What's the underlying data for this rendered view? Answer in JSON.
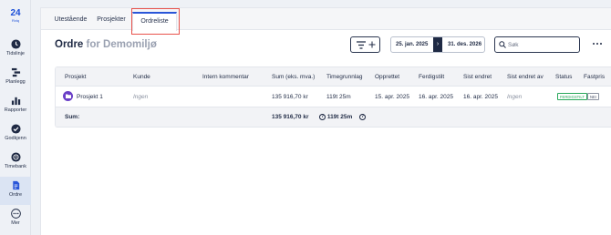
{
  "sidebar": {
    "logo": {
      "number": "24",
      "text": "Rviq"
    },
    "items": [
      {
        "label": "Tidslinje",
        "icon": "clock-icon"
      },
      {
        "label": "Planlegg",
        "icon": "plan-icon"
      },
      {
        "label": "Rapporter",
        "icon": "bar-chart-icon"
      },
      {
        "label": "Godkjenn",
        "icon": "check-circle-icon"
      },
      {
        "label": "Timebank",
        "icon": "timebank-icon"
      },
      {
        "label": "Ordre",
        "icon": "document-icon",
        "active": true
      },
      {
        "label": "Mer",
        "icon": "more-icon"
      }
    ]
  },
  "tabs": [
    {
      "label": "Utestående"
    },
    {
      "label": "Prosjekter"
    },
    {
      "label": "Ordreliste",
      "active": true
    }
  ],
  "header": {
    "title": "Ordre",
    "env": "for Demomiljø",
    "date_from": "25. jan. 2025",
    "date_to": "31. des. 2026",
    "search_placeholder": "Søk"
  },
  "table": {
    "columns": [
      "Prosjekt",
      "Kunde",
      "Intern kommentar",
      "Sum (eks. mva.)",
      "Timegrunnlag",
      "Opprettet",
      "Ferdigstilt",
      "Sist endret",
      "Sist endret av",
      "Status",
      "Fastpris"
    ],
    "rows": [
      {
        "prosjekt": "Prosjekt 1",
        "kunde": "Ingen",
        "intern_kommentar": "",
        "sum": "135 916,70 kr",
        "timegrunnlag": "119t 25m",
        "opprettet": "15. apr. 2025",
        "ferdigstilt": "16. apr. 2025",
        "sist_endret": "16. apr. 2025",
        "sist_endret_av": "Ingen",
        "status": "FERDIGSTILT",
        "fastpris": "NEI"
      }
    ],
    "sum_row": {
      "label": "Sum:",
      "sum": "135 916,70 kr",
      "timegrunnlag": "119t 25m",
      "help_mark": "?"
    }
  },
  "colors": {
    "accent": "#2a56d8",
    "project_icon": "#6a3fc7",
    "status_done": "#27a85a",
    "highlight": "#e8524c"
  }
}
